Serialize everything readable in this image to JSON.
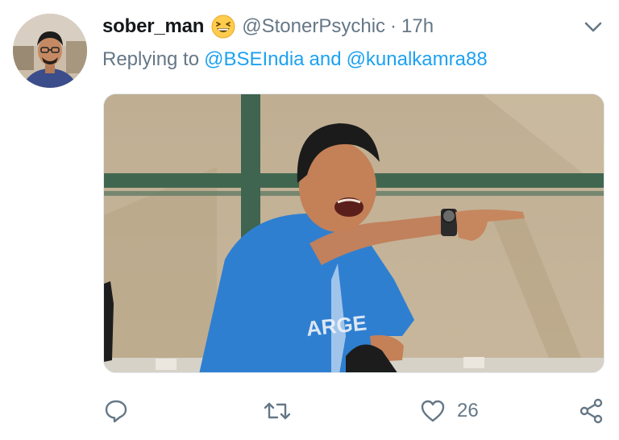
{
  "tweet": {
    "display_name": "sober_man",
    "emoji": "grinning-squinting-face",
    "handle": "@StonerPsychic",
    "separator": "·",
    "time": "17h",
    "reply": {
      "prefix": "Replying to",
      "mention_1": "@BSEIndia",
      "joiner": "and",
      "mention_2": "@kunalkamra88"
    },
    "media": {
      "description_icon": "photo-image",
      "shirt_text": "ARGE"
    },
    "actions": {
      "reply_icon": "comment-icon",
      "retweet_icon": "retweet-icon",
      "like_icon": "heart-icon",
      "like_count": "26",
      "share_icon": "share-icon"
    }
  },
  "colors": {
    "name": "#14171a",
    "secondary": "#657786",
    "link": "#1da1f2",
    "shirt": "#2f7fd1"
  }
}
